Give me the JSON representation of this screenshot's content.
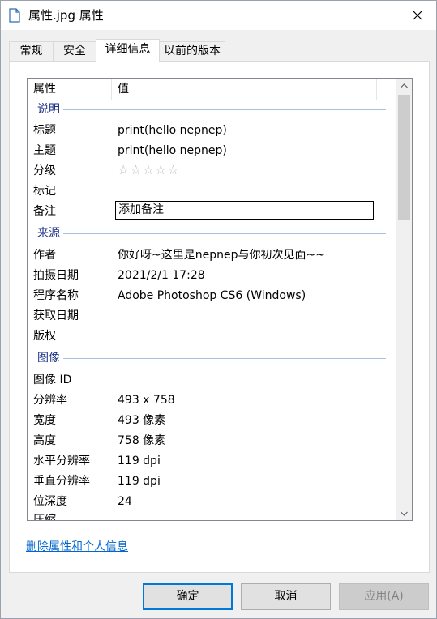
{
  "window": {
    "title": "属性.jpg 属性",
    "close_icon": "close-icon"
  },
  "tabs": [
    {
      "label": "常规"
    },
    {
      "label": "安全"
    },
    {
      "label": "详细信息",
      "active": true
    },
    {
      "label": "以前的版本"
    }
  ],
  "list": {
    "header": {
      "name": "属性",
      "value": "值"
    },
    "groups": {
      "description": {
        "title": "说明",
        "rows": {
          "title": {
            "name": "标题",
            "value": "print(hello nepnep)"
          },
          "subject": {
            "name": "主题",
            "value": "print(hello nepnep)"
          },
          "rating": {
            "name": "分级",
            "value": "☆☆☆☆☆",
            "stars_filled": 0,
            "stars_total": 5
          },
          "tags": {
            "name": "标记",
            "value": ""
          },
          "comments": {
            "name": "备注",
            "value": "添加备注"
          }
        }
      },
      "origin": {
        "title": "来源",
        "rows": {
          "author": {
            "name": "作者",
            "value": "你好呀~这里是nepnep与你初次见面~~"
          },
          "date_taken": {
            "name": "拍摄日期",
            "value": "2021/2/1 17:28"
          },
          "program": {
            "name": "程序名称",
            "value": "Adobe Photoshop CS6 (Windows)"
          },
          "date_acquired": {
            "name": "获取日期",
            "value": ""
          },
          "copyright": {
            "name": "版权",
            "value": ""
          }
        }
      },
      "image": {
        "title": "图像",
        "rows": {
          "image_id": {
            "name": "图像 ID",
            "value": ""
          },
          "dimensions": {
            "name": "分辨率",
            "value": "493 x 758"
          },
          "width": {
            "name": "宽度",
            "value": "493 像素"
          },
          "height": {
            "name": "高度",
            "value": "758 像素"
          },
          "h_res": {
            "name": "水平分辨率",
            "value": "119 dpi"
          },
          "v_res": {
            "name": "垂直分辨率",
            "value": "119 dpi"
          },
          "bit_depth": {
            "name": "位深度",
            "value": "24"
          },
          "compression": {
            "name": "压缩",
            "value": ""
          }
        }
      }
    }
  },
  "remove_link": "删除属性和个人信息",
  "buttons": {
    "ok": "确定",
    "cancel": "取消",
    "apply": "应用(A)"
  }
}
